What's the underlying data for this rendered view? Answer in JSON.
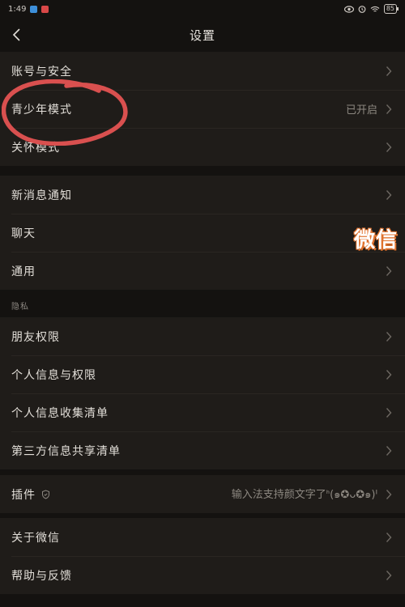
{
  "status_bar": {
    "time": "1:49",
    "battery": "85"
  },
  "header": {
    "title": "设置"
  },
  "groups": {
    "group1": [
      {
        "label": "账号与安全",
        "value": ""
      },
      {
        "label": "青少年模式",
        "value": "已开启"
      },
      {
        "label": "关怀模式",
        "value": ""
      }
    ],
    "group2": [
      {
        "label": "新消息通知",
        "value": ""
      },
      {
        "label": "聊天",
        "value": ""
      },
      {
        "label": "通用",
        "value": ""
      }
    ],
    "privacy_label": "隐私",
    "group3": [
      {
        "label": "朋友权限",
        "value": ""
      },
      {
        "label": "个人信息与权限",
        "value": ""
      },
      {
        "label": "个人信息收集清单",
        "value": ""
      },
      {
        "label": "第三方信息共享清单",
        "value": ""
      }
    ],
    "group4": [
      {
        "label": "插件",
        "value": "输入法支持颜文字了ᑋ(๑✪ᴗ✪๑)ᑊ"
      }
    ],
    "group5": [
      {
        "label": "关于微信",
        "value": ""
      },
      {
        "label": "帮助与反馈",
        "value": ""
      }
    ]
  },
  "overlay": {
    "watermark_text": "微信"
  },
  "colors": {
    "background": "#141210",
    "section": "#1f1c19",
    "annotation": "#d9504f",
    "watermark_outline": "#e0722d"
  }
}
